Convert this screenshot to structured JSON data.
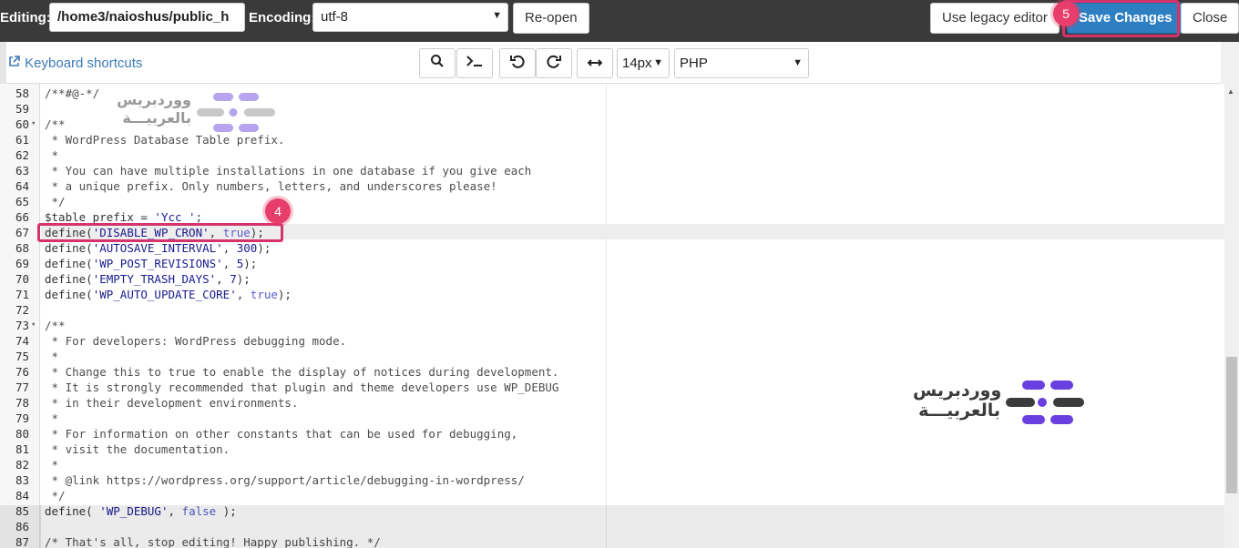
{
  "topbar": {
    "editing_label": "Editing:",
    "path_value": "/home3/naioshus/public_h",
    "encoding_label": "Encoding:",
    "encoding_value": "utf-8",
    "reopen_label": "Re-open",
    "legacy_label": "Use legacy editor",
    "save_label": "Save Changes",
    "close_label": "Close",
    "save_step": "5"
  },
  "toolbar": {
    "shortcuts_label": "Keyboard shortcuts",
    "font_size": "14px",
    "mode": "PHP"
  },
  "annotation": {
    "line_step": "4"
  },
  "logo": {
    "line1": "ووردبريس",
    "line2": "بالعربيـــة"
  },
  "colors": {
    "highlight": "#d6336c",
    "save_bg": "#2d7fc1",
    "link": "#3d7ab8"
  },
  "code_lines": [
    {
      "n": "58",
      "text": "/**#@-*/"
    },
    {
      "n": "59",
      "text": ""
    },
    {
      "n": "60",
      "text": "/**",
      "fold": true
    },
    {
      "n": "61",
      "text": " * WordPress Database Table prefix."
    },
    {
      "n": "62",
      "text": " *"
    },
    {
      "n": "63",
      "text": " * You can have multiple installations in one database if you give each"
    },
    {
      "n": "64",
      "text": " * a unique prefix. Only numbers, letters, and underscores please!"
    },
    {
      "n": "65",
      "text": " */"
    },
    {
      "n": "66",
      "text": "$table_prefix = 'Ycc_';"
    },
    {
      "n": "67",
      "text": "define('DISABLE_WP_CRON', true);"
    },
    {
      "n": "68",
      "text": "define('AUTOSAVE_INTERVAL', 300);"
    },
    {
      "n": "69",
      "text": "define('WP_POST_REVISIONS', 5);"
    },
    {
      "n": "70",
      "text": "define('EMPTY_TRASH_DAYS', 7);"
    },
    {
      "n": "71",
      "text": "define('WP_AUTO_UPDATE_CORE', true);"
    },
    {
      "n": "72",
      "text": ""
    },
    {
      "n": "73",
      "text": "/**",
      "fold": true
    },
    {
      "n": "74",
      "text": " * For developers: WordPress debugging mode."
    },
    {
      "n": "75",
      "text": " *"
    },
    {
      "n": "76",
      "text": " * Change this to true to enable the display of notices during development."
    },
    {
      "n": "77",
      "text": " * It is strongly recommended that plugin and theme developers use WP_DEBUG"
    },
    {
      "n": "78",
      "text": " * in their development environments."
    },
    {
      "n": "79",
      "text": " *"
    },
    {
      "n": "80",
      "text": " * For information on other constants that can be used for debugging,"
    },
    {
      "n": "81",
      "text": " * visit the documentation."
    },
    {
      "n": "82",
      "text": " *"
    },
    {
      "n": "83",
      "text": " * @link https://wordpress.org/support/article/debugging-in-wordpress/"
    },
    {
      "n": "84",
      "text": " */"
    },
    {
      "n": "85",
      "text": "define( 'WP_DEBUG', false );"
    },
    {
      "n": "86",
      "text": ""
    },
    {
      "n": "87",
      "text": "/* That's all, stop editing! Happy publishing. */"
    }
  ]
}
